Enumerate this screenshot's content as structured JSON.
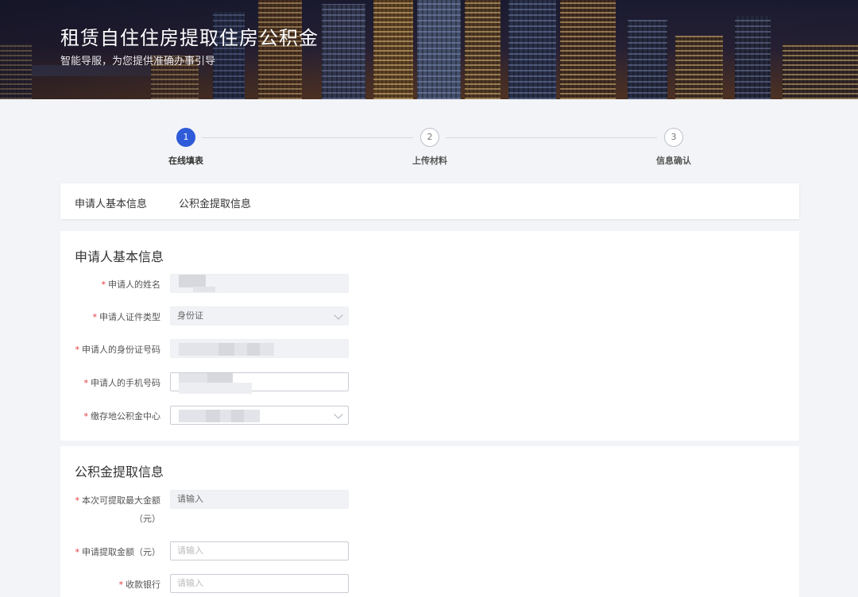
{
  "banner": {
    "title": "租赁自住住房提取住房公积金",
    "subtitle": "智能导服，为您提供准确办事引导"
  },
  "steps": [
    {
      "number": "1",
      "label": "在线填表",
      "active": true
    },
    {
      "number": "2",
      "label": "上传材料",
      "active": false
    },
    {
      "number": "3",
      "label": "信息确认",
      "active": false
    }
  ],
  "tabs": [
    "申请人基本信息",
    "公积金提取信息"
  ],
  "applicant_section": {
    "title": "申请人基本信息",
    "fields": [
      {
        "label": "申请人的姓名",
        "required": true,
        "type": "disabled",
        "value": ""
      },
      {
        "label": "申请人证件类型",
        "required": true,
        "type": "select-disabled",
        "value": "身份证"
      },
      {
        "label": "申请人的身份证号码",
        "required": true,
        "type": "disabled",
        "value": ""
      },
      {
        "label": "申请人的手机号码",
        "required": true,
        "type": "input",
        "value": ""
      },
      {
        "label": "缴存地公积金中心",
        "required": true,
        "type": "select",
        "value": ""
      }
    ]
  },
  "withdraw_section": {
    "title": "公积金提取信息",
    "fields": [
      {
        "label": "本次可提取最大金额",
        "label_line2": "（元）",
        "required": true,
        "type": "disabled",
        "placeholder": "请输入"
      },
      {
        "label": "申请提取金额（元）",
        "required": true,
        "type": "input",
        "placeholder": "请输入"
      },
      {
        "label": "收款银行",
        "required": true,
        "type": "input",
        "placeholder": "请输入"
      }
    ]
  },
  "colors": {
    "accent": "#2f5bd9",
    "required": "#e4393c",
    "page_bg": "#f3f4f7"
  }
}
